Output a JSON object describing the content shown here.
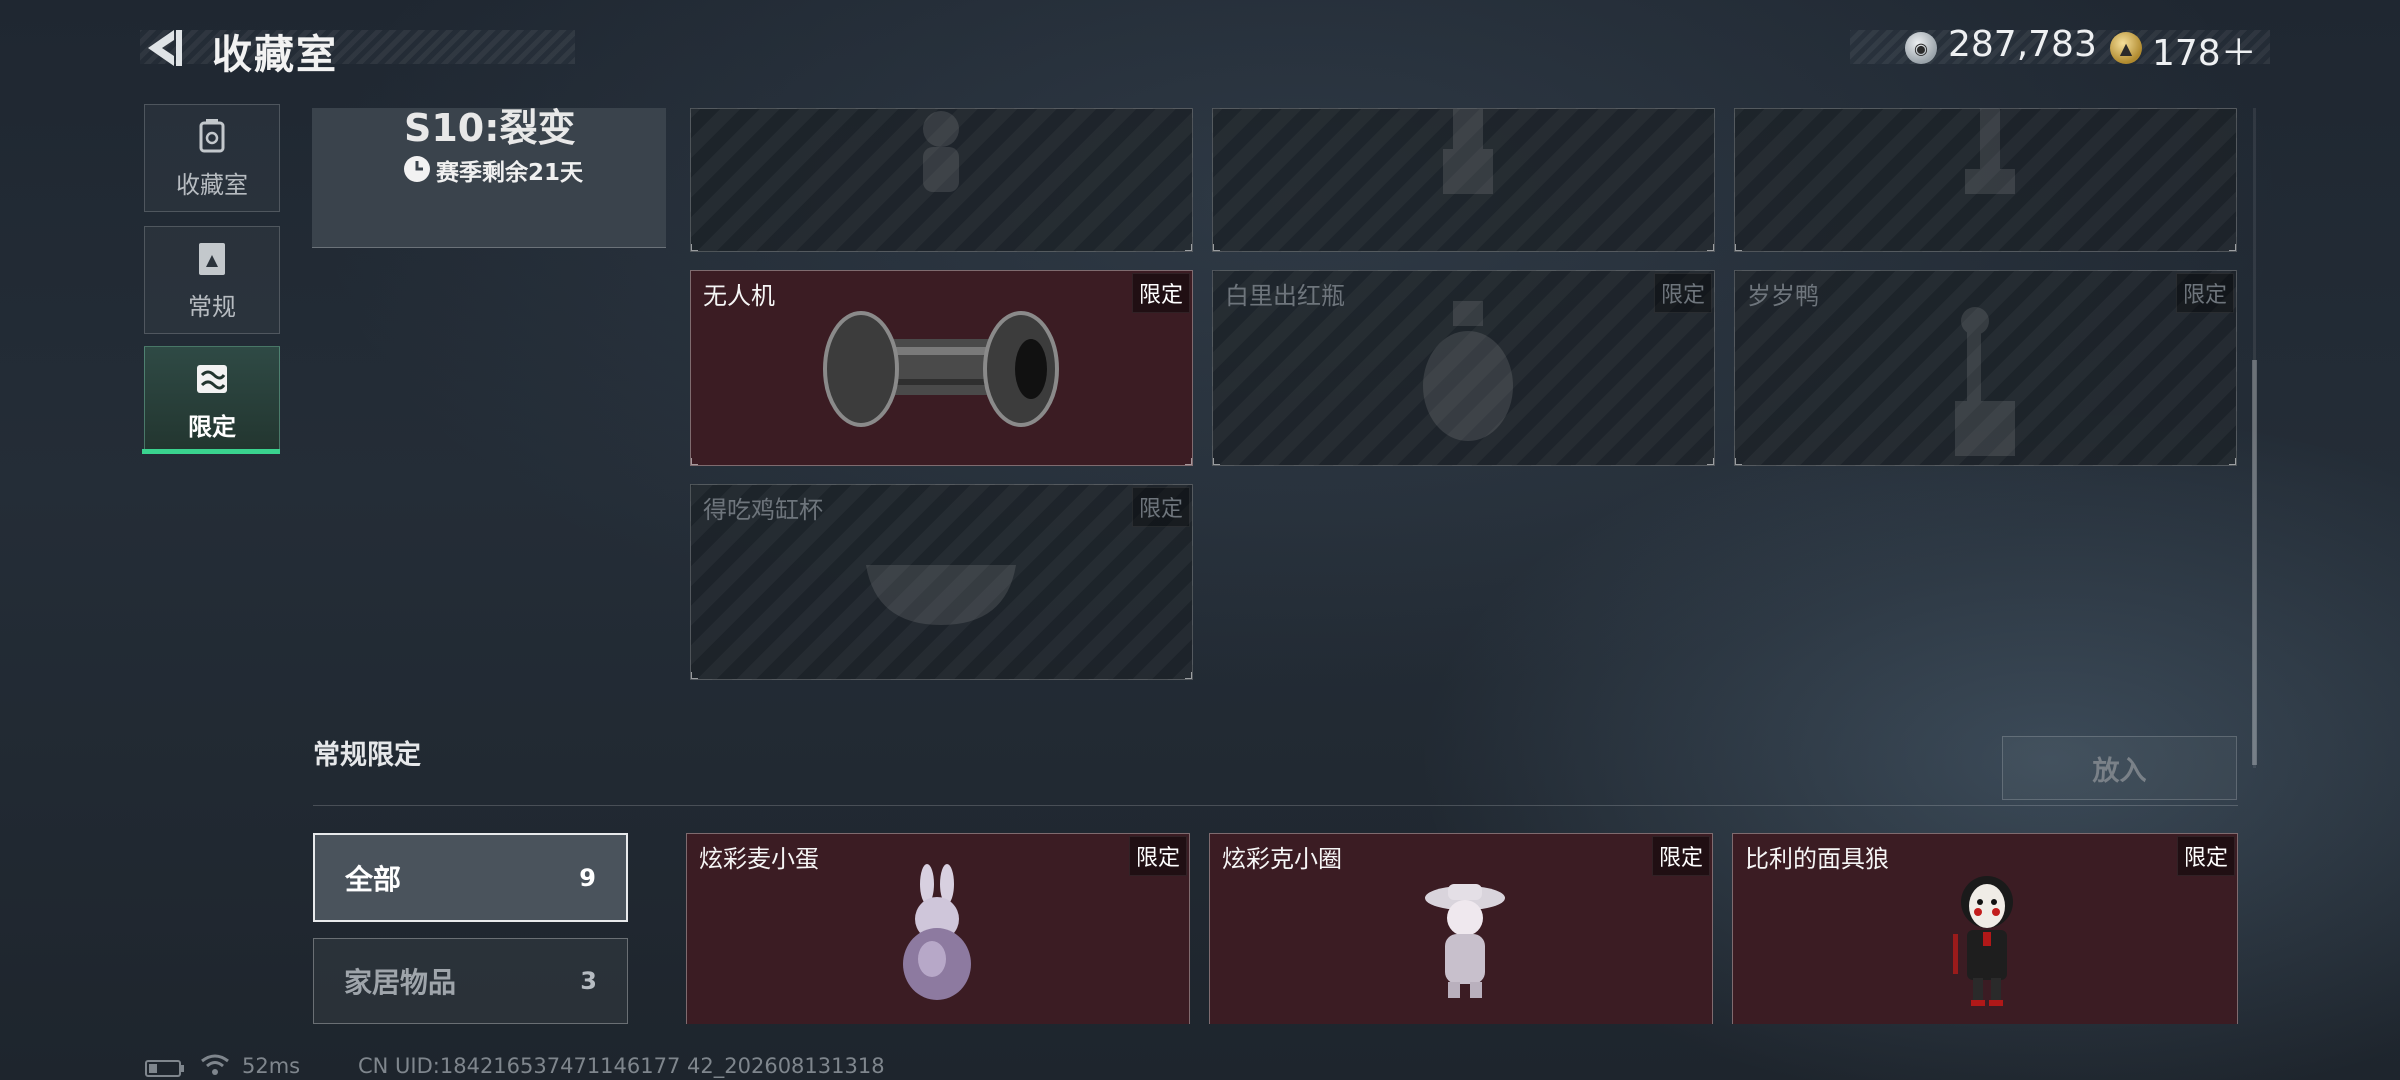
{
  "header": {
    "title": "收藏室",
    "currency_silver": "287,783",
    "currency_gold": "178"
  },
  "sidebar": {
    "tabs": [
      {
        "label": "收藏室",
        "icon": "trash-bin-icon"
      },
      {
        "label": "常规",
        "icon": "book-icon"
      },
      {
        "label": "限定",
        "icon": "image-frame-icon",
        "active": true
      }
    ]
  },
  "season": {
    "title": "S10:裂变",
    "time_left": "赛季剩余21天"
  },
  "limited_items": [
    {
      "name": "无人机",
      "badge": "限定",
      "owned": true
    },
    {
      "name": "白里出红瓶",
      "badge": "限定",
      "owned": false
    },
    {
      "name": "岁岁鸭",
      "badge": "限定",
      "owned": false
    },
    {
      "name": "得吃鸡缸杯",
      "badge": "限定",
      "owned": false
    }
  ],
  "section2": {
    "title": "常规限定",
    "place_button": "放入",
    "filters": [
      {
        "label": "全部",
        "count": "9",
        "active": true
      },
      {
        "label": "家居物品",
        "count": "3",
        "active": false
      }
    ],
    "items": [
      {
        "name": "炫彩麦小蛋",
        "badge": "限定",
        "owned": true
      },
      {
        "name": "炫彩克小圈",
        "badge": "限定",
        "owned": true
      },
      {
        "name": "比利的面具狼",
        "badge": "限定",
        "owned": true
      }
    ]
  },
  "status": {
    "ping": "52ms",
    "uid": "CN UID:184216537471146177 42_202608131318"
  },
  "colors": {
    "accent_green": "#3ad38f",
    "owned_card": "#3b1c23",
    "background": "#222a33"
  }
}
